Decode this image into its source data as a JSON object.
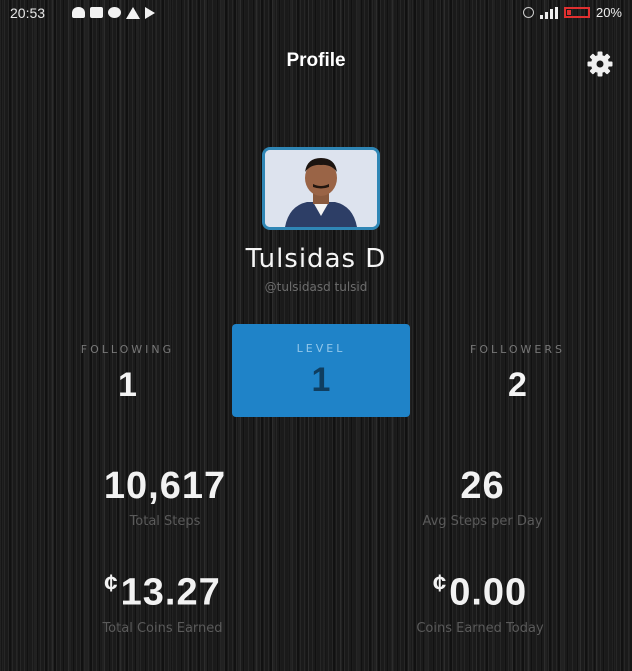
{
  "status_bar": {
    "time": "20:53",
    "battery": "20%"
  },
  "header": {
    "title": "Profile"
  },
  "user": {
    "name": "Tulsidas D",
    "subtitle": "@tulsidasd tulsid"
  },
  "stats": {
    "following": {
      "label": "FOLLOWING",
      "value": "1"
    },
    "level": {
      "label": "LEVEL",
      "value": "1"
    },
    "followers": {
      "label": "FOLLOWERS",
      "value": "2"
    }
  },
  "totals": {
    "steps": {
      "value": "10,617",
      "label": "Total Steps"
    },
    "avg": {
      "value": "26",
      "label": "Avg Steps per Day"
    },
    "coins_earned": {
      "symbol": "¢",
      "value": "13.27",
      "label": "Total Coins Earned"
    },
    "coins_today": {
      "symbol": "¢",
      "value": "0.00",
      "label": "Coins Earned Today"
    }
  },
  "colors": {
    "accent": "#1f83c8",
    "avatar_border": "#2f86b5",
    "battery": "#e03030"
  },
  "icons": [
    "settings-icon",
    "signal-icon",
    "battery-icon"
  ]
}
